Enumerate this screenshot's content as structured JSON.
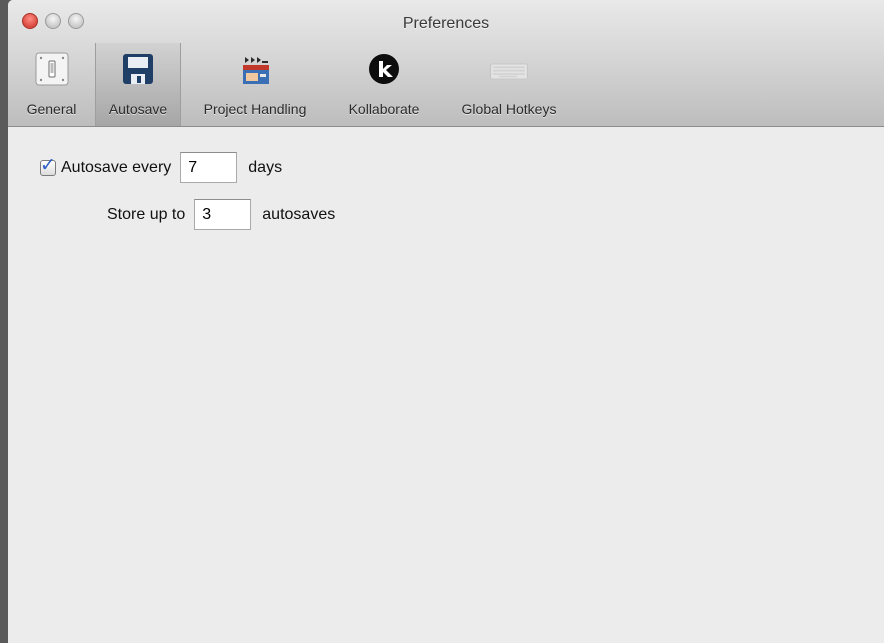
{
  "window": {
    "title": "Preferences"
  },
  "toolbar": {
    "items": [
      {
        "label": "General",
        "icon": "light-switch-icon"
      },
      {
        "label": "Autosave",
        "icon": "floppy-disk-icon",
        "selected": true
      },
      {
        "label": "Project Handling",
        "icon": "clapperboard-icon"
      },
      {
        "label": "Kollaborate",
        "icon": "kollaborate-k-icon"
      },
      {
        "label": "Global Hotkeys",
        "icon": "keyboard-icon"
      }
    ]
  },
  "autosave": {
    "enabled": true,
    "every_label": "Autosave every",
    "every_value": "7",
    "every_unit": "days",
    "store_label": "Store up to",
    "store_value": "3",
    "store_unit": "autosaves"
  },
  "colors": {
    "accent": "#2f5fc7",
    "window_bg": "#ececec",
    "toolbar_bg": "#d6d6d6"
  }
}
